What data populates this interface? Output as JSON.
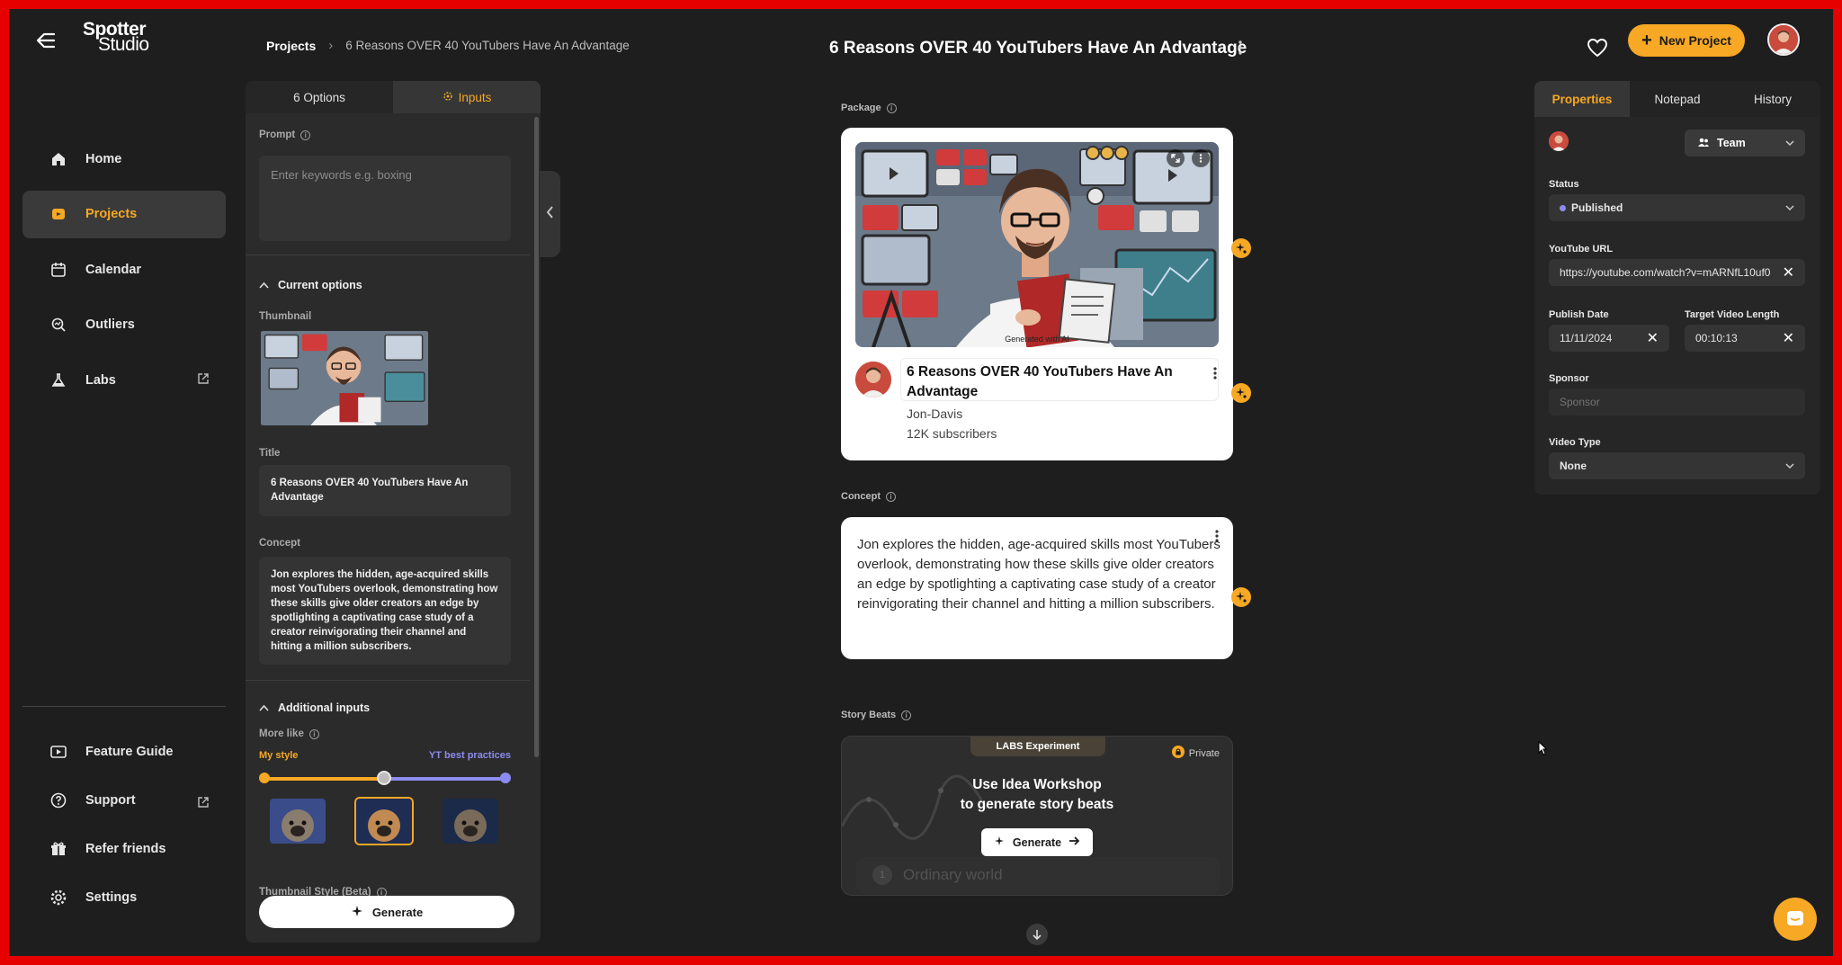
{
  "app": {
    "logo_line1": "Spotter",
    "logo_line2": "Studio",
    "accent_color": "#f7a824"
  },
  "breadcrumb": {
    "root": "Projects",
    "current": "6 Reasons OVER 40 YouTubers Have An Advantage"
  },
  "header": {
    "title": "6 Reasons OVER 40 YouTubers Have An Advantage",
    "new_project_label": "New Project"
  },
  "nav": {
    "items": [
      {
        "label": "Home",
        "icon": "home-icon"
      },
      {
        "label": "Projects",
        "icon": "folder-icon"
      },
      {
        "label": "Calendar",
        "icon": "calendar-icon"
      },
      {
        "label": "Outliers",
        "icon": "outliers-icon"
      },
      {
        "label": "Labs",
        "icon": "flask-icon"
      }
    ],
    "bottom": [
      {
        "label": "Feature Guide",
        "icon": "play-guide-icon"
      },
      {
        "label": "Support",
        "icon": "question-icon"
      },
      {
        "label": "Refer friends",
        "icon": "gift-icon"
      },
      {
        "label": "Settings",
        "icon": "gear-icon"
      }
    ]
  },
  "generator": {
    "tabs": [
      "6 Options",
      "Inputs"
    ],
    "active_tab": "Inputs",
    "prompt_label": "Prompt",
    "prompt_placeholder": "Enter keywords e.g. boxing",
    "current_options_label": "Current options",
    "thumbnail_label": "Thumbnail",
    "title_label": "Title",
    "title_value": "6 Reasons OVER 40 YouTubers Have An Advantage",
    "concept_label": "Concept",
    "concept_value": "Jon explores the hidden, age-acquired skills most YouTubers overlook, demonstrating how these skills give older creators an edge by spotlighting a captivating case study of a creator reinvigorating their channel and hitting a million subscribers.",
    "additional_inputs_label": "Additional inputs",
    "more_like_label": "More like",
    "slider_left": "My style",
    "slider_right": "YT best practices",
    "slider_value": 0.5,
    "thumbnail_style_label": "Thumbnail Style (Beta)",
    "generate_label": "Generate"
  },
  "package": {
    "label": "Package",
    "thumb_caption": "Generated with AI",
    "video_title": "6 Reasons OVER 40 YouTubers Have An Advantage",
    "channel_name": "Jon-Davis",
    "subscribers": "12K subscribers"
  },
  "concept": {
    "label": "Concept",
    "text": "Jon explores the hidden, age-acquired skills most YouTubers overlook, demonstrating how these skills give older creators an edge by spotlighting a captivating case study of a creator reinvigorating their channel and hitting a million subscribers."
  },
  "story_beats": {
    "label": "Story Beats",
    "badge": "LABS Experiment",
    "private_label": "Private",
    "line1": "Use Idea Workshop",
    "line2": "to generate story beats",
    "generate_label": "Generate",
    "ghost_number": "1",
    "ghost_text": "Ordinary world"
  },
  "properties": {
    "tabs": [
      "Properties",
      "Notepad",
      "History"
    ],
    "active_tab": "Properties",
    "team_label": "Team",
    "status_label": "Status",
    "status_value": "Published",
    "status_color": "#8c8cf0",
    "youtube_url_label": "YouTube URL",
    "youtube_url_value": "https://youtube.com/watch?v=mARNfL10uf0",
    "publish_date_label": "Publish Date",
    "publish_date_value": "11/11/2024",
    "target_length_label": "Target Video Length",
    "target_length_value": "00:10:13",
    "sponsor_label": "Sponsor",
    "sponsor_placeholder": "Sponsor",
    "video_type_label": "Video Type",
    "video_type_value": "None"
  }
}
